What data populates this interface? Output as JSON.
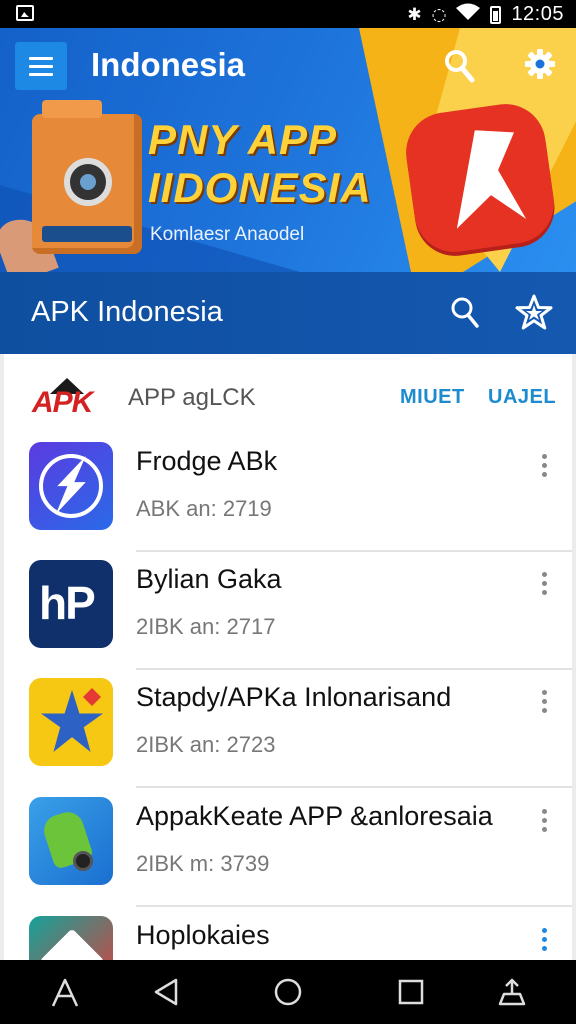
{
  "status_bar": {
    "time": "12:05",
    "icons": [
      "notification-icon",
      "bluetooth-icon",
      "vibrate-icon",
      "wifi-icon",
      "battery-icon"
    ]
  },
  "banner": {
    "title": "Indonesia",
    "promo_line1": "PNY APP",
    "promo_line2": "IIDONESIA",
    "promo_sub": "Komlaesr Anaodel",
    "colors": {
      "blue": "#1d72d9",
      "yellow": "#f6b318",
      "red": "#e53222"
    }
  },
  "titlebar": {
    "title": "APK Indonesia"
  },
  "list": {
    "header_logo": "APK",
    "header_label": "APP agLCK",
    "tabs": [
      "MIUET",
      "UAJEL"
    ],
    "apps": [
      {
        "name": "Frodge ABk",
        "meta": "ABK an: 2719",
        "icon": "lightning-app-icon"
      },
      {
        "name": "Bylian Gaka",
        "meta": "2IBK an: 2717",
        "icon": "hp-app-icon"
      },
      {
        "name": "Stapdy/APKa Inlonarisand",
        "meta": "2IBK an: 2723",
        "icon": "star-app-icon"
      },
      {
        "name": "AppakKeate APP &anloresaia",
        "meta": "2IBK m: 3739",
        "icon": "android-app-icon"
      },
      {
        "name": "Hoplokaies",
        "meta": "",
        "icon": "diamond-app-icon"
      }
    ]
  },
  "navbar": {
    "buttons": [
      "recent-apps-icon",
      "back-icon",
      "home-icon",
      "overview-icon",
      "share-icon"
    ]
  }
}
